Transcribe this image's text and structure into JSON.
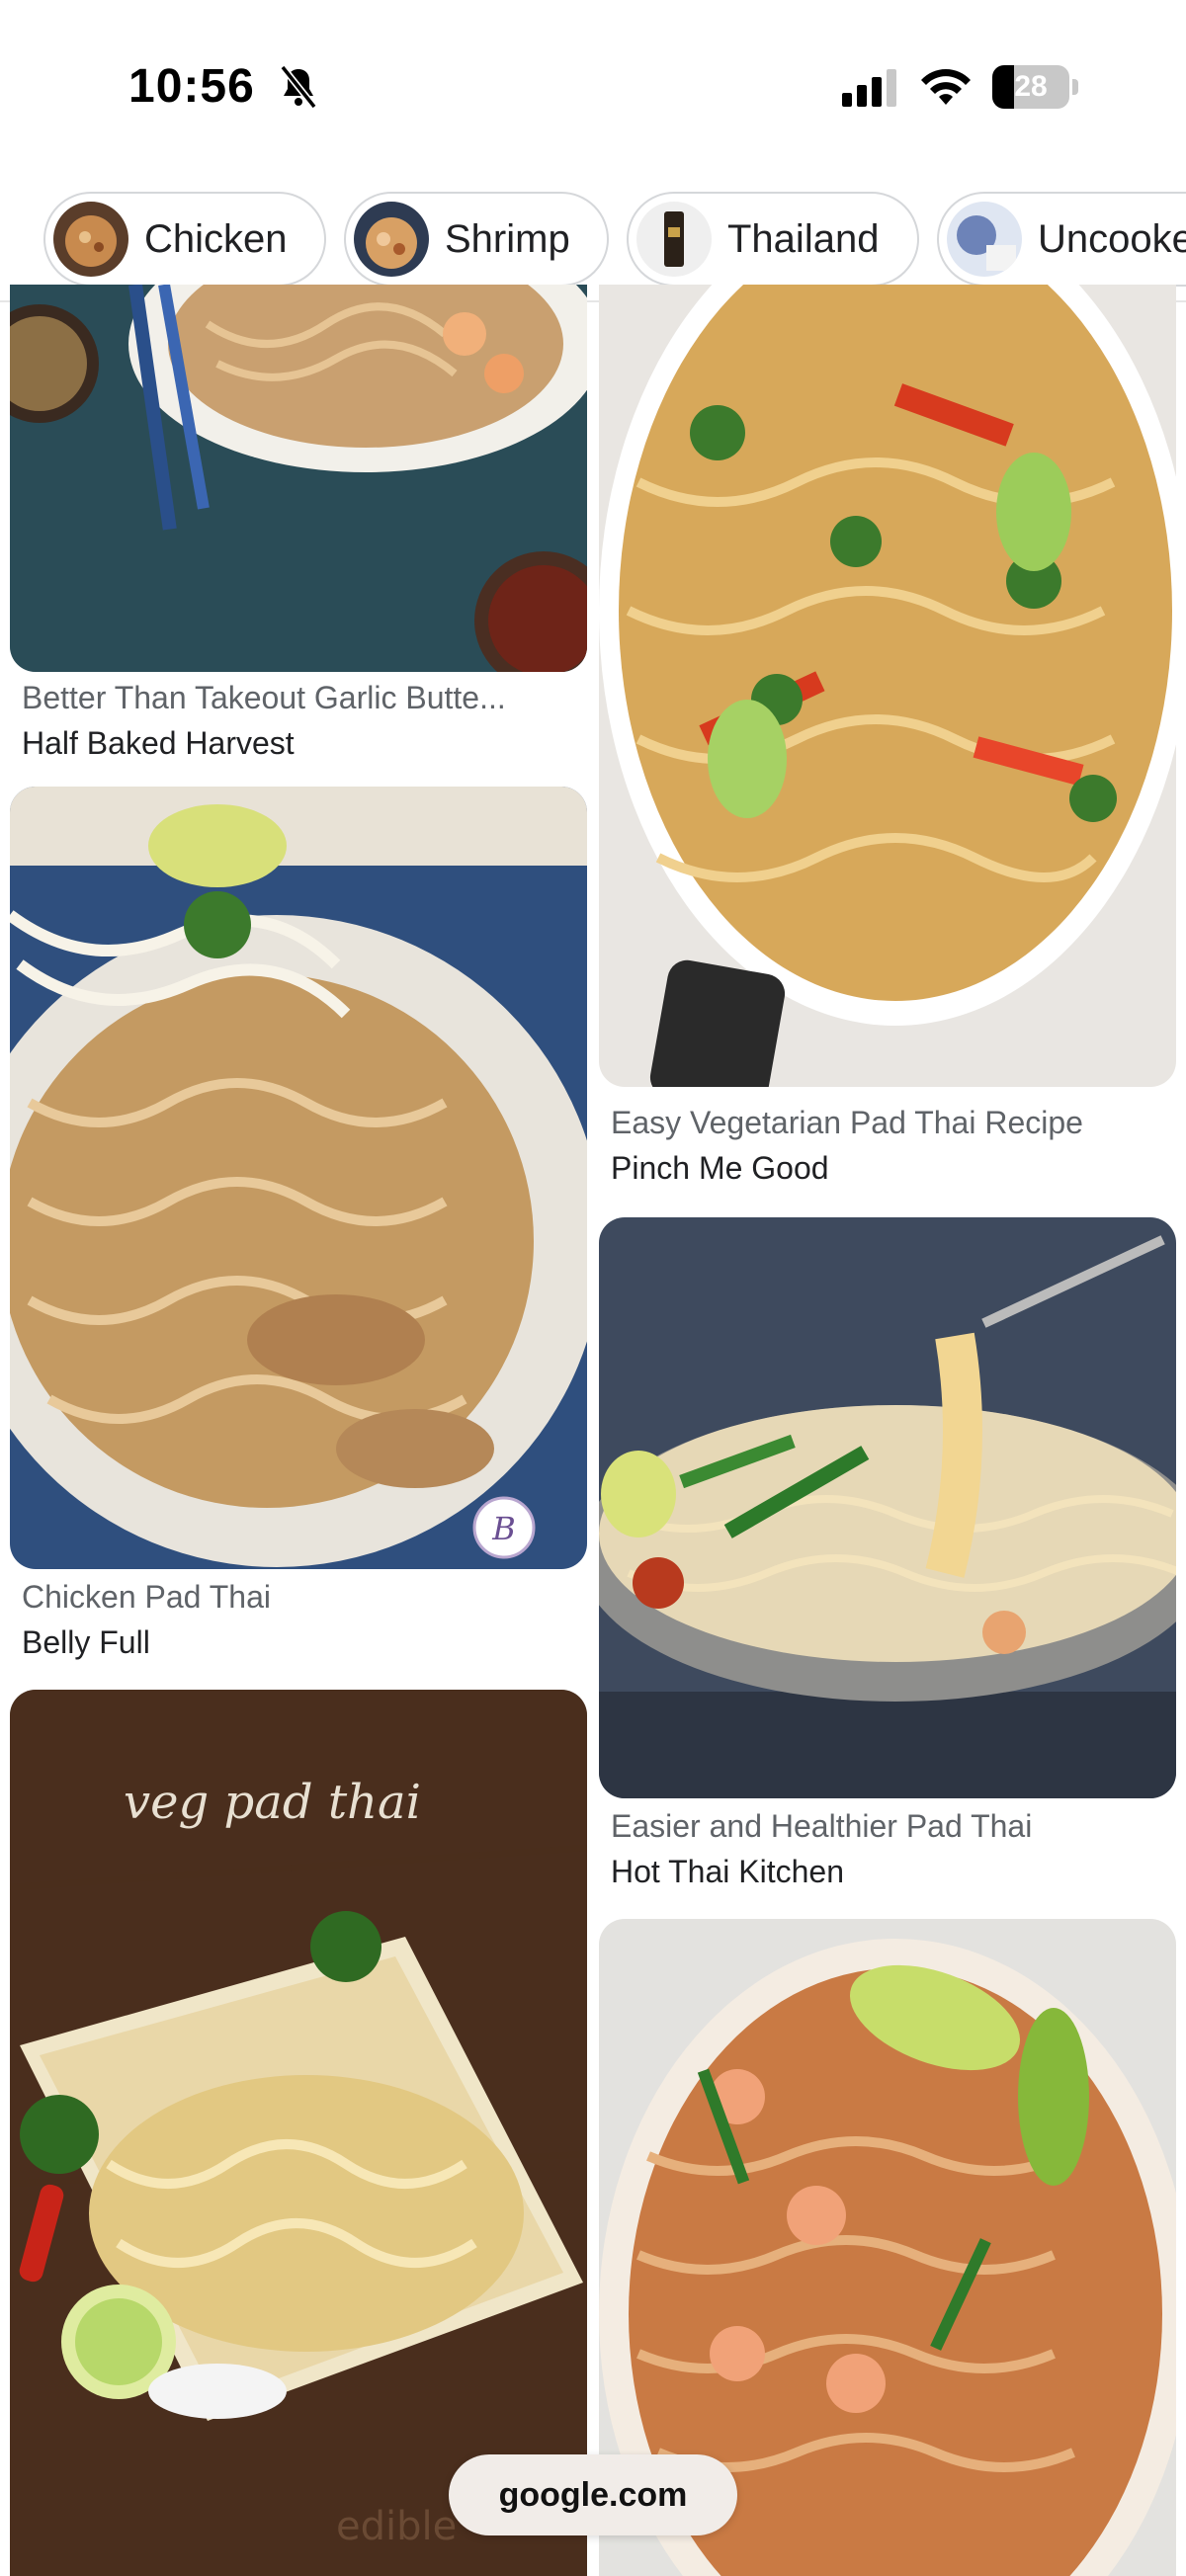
{
  "status_bar": {
    "time": "10:56",
    "battery_level": "28",
    "icons": [
      "bell-slash-icon",
      "signal-icon",
      "wifi-icon",
      "battery-icon"
    ]
  },
  "chips": [
    {
      "label": "Chicken",
      "thumb_color": "#a06a3a"
    },
    {
      "label": "Shrimp",
      "thumb_color": "#8a5c36"
    },
    {
      "label": "Thailand",
      "thumb_color": "#3a2d22"
    },
    {
      "label": "Uncooked",
      "thumb_color": "#7b8fb5"
    }
  ],
  "results": [
    {
      "title": "Better Than Takeout Garlic Butte...",
      "source": "Half Baked Harvest"
    },
    {
      "title": "Easy Vegetarian Pad Thai Recipe",
      "source": "Pinch Me Good"
    },
    {
      "title": "Chicken Pad Thai",
      "source": "Belly Full"
    },
    {
      "title": "Easier and Healthier Pad Thai",
      "source": "Hot Thai Kitchen"
    },
    {
      "title": "",
      "source": "",
      "image_text": "veg pad thai"
    },
    {
      "title": "",
      "source": ""
    }
  ],
  "overlay": {
    "url": "google.com",
    "watermark": "edible",
    "badge_letter": "B"
  }
}
